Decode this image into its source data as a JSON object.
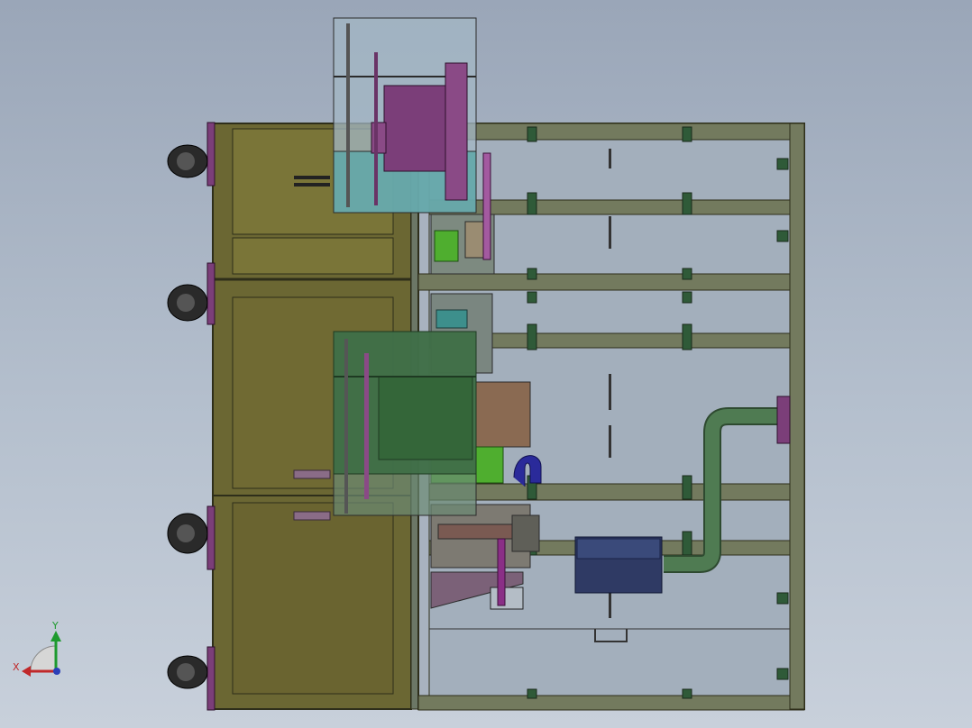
{
  "viewport": {
    "background_top": "#9aa6b8",
    "background_bottom": "#c8d0db"
  },
  "model": {
    "cabinet_color": "#6f6a35",
    "frame_color": "#5f6658",
    "glass_color": "#9fb1bf",
    "motor_purple": "#7b3e79",
    "motor_green": "#3e6e45",
    "pipe_green": "#4f7b52",
    "motor_box_blue": "#3a4a7a"
  },
  "triad": {
    "x_label": "X",
    "y_label": "Y",
    "x_color": "#c0282a",
    "y_color": "#1e9a2e",
    "z_color": "#2b3fb8"
  }
}
